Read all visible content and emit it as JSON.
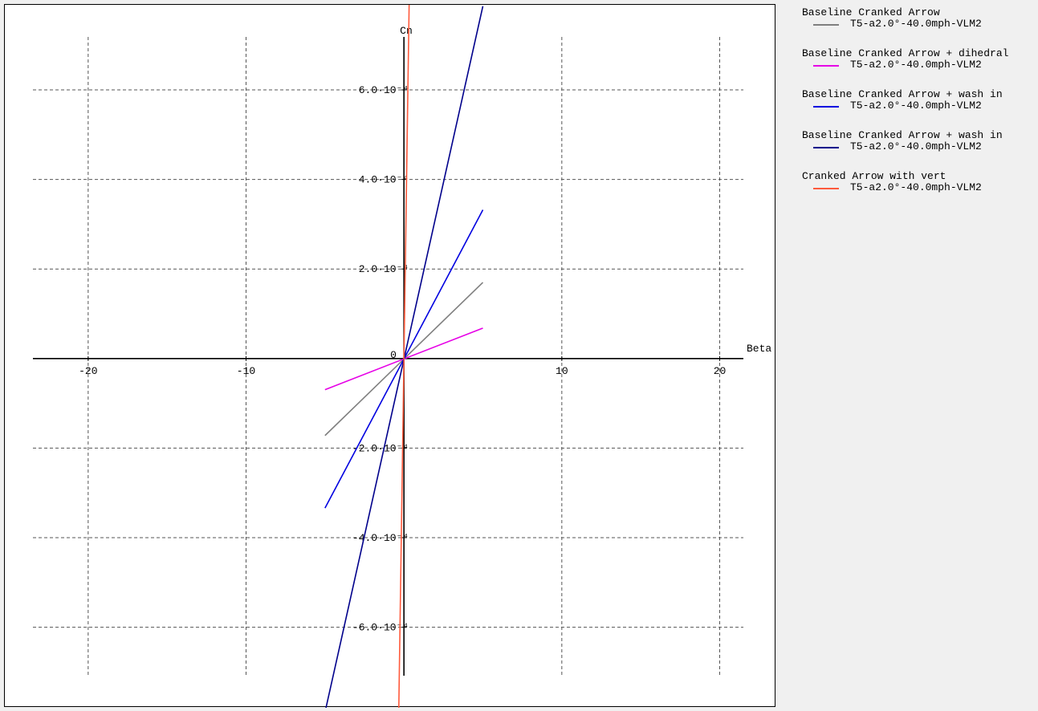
{
  "chart_data": {
    "type": "line",
    "xlabel": "Beta",
    "ylabel": "Cn",
    "xlim": [
      -23.5,
      21.5
    ],
    "ylim": [
      -0.00078,
      0.00079
    ],
    "grid": true,
    "legend_position": "right",
    "x_ticks": [
      {
        "value": -20,
        "label": "-20"
      },
      {
        "value": -10,
        "label": "-10"
      },
      {
        "value": 10,
        "label": "10"
      },
      {
        "value": 20,
        "label": "20"
      }
    ],
    "y_ticks": [
      {
        "value": 0.0006,
        "label": "6.0·10⁻⁴"
      },
      {
        "value": 0.0004,
        "label": "4.0·10⁻⁴"
      },
      {
        "value": 0.0002,
        "label": "2.0·10⁻⁴"
      },
      {
        "value": -0.0002,
        "label": "-2.0·10⁻⁴"
      },
      {
        "value": -0.0004,
        "label": "-4.0·10⁻⁴"
      },
      {
        "value": -0.0006,
        "label": "-6.0·10⁻⁴"
      }
    ],
    "origin_label": "0",
    "series": [
      {
        "name": "Baseline Cranked Arrow",
        "sub": "T5-a2.0°-40.0mph-VLM2",
        "color": "#7f7f7f",
        "x": [
          -5,
          5
        ],
        "y": [
          -0.000172,
          0.00017
        ]
      },
      {
        "name": "Baseline Cranked Arrow + dihedral",
        "sub": "T5-a2.0°-40.0mph-VLM2",
        "color": "#e600e6",
        "x": [
          -5,
          5
        ],
        "y": [
          -6.95e-05,
          6.8e-05
        ]
      },
      {
        "name": "Baseline Cranked Arrow + wash in",
        "sub": "T5-a2.0°-40.0mph-VLM2",
        "color": "#0000e0",
        "x": [
          -5,
          5
        ],
        "y": [
          -0.000334,
          0.000332
        ]
      },
      {
        "name": "Baseline Cranked Arrow + wash in",
        "sub": "T5-a2.0°-40.0mph-VLM2",
        "color": "#00008b",
        "x": [
          -5,
          5
        ],
        "y": [
          -0.00079,
          0.000787
        ]
      },
      {
        "name": "Cranked Arrow with vert",
        "sub": "T5-a2.0°-40.0mph-VLM2",
        "color": "#ff5a3c",
        "x": [
          -0.35,
          0.35
        ],
        "y": [
          -0.00084,
          0.00084
        ]
      }
    ]
  }
}
